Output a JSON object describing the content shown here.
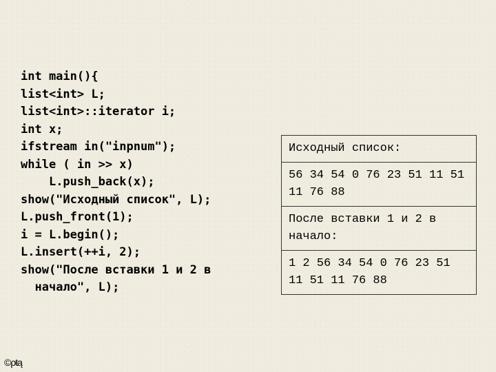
{
  "code": {
    "lines": [
      "int main(){",
      "list<int> L;",
      "list<int>::iterator i;",
      "int x;",
      "ifstream in(\"inpnum\");",
      "while ( in >> x)",
      "    L.push_back(x);",
      "show(\"Исходный список\", L);",
      "L.push_front(1);",
      "i = L.begin();",
      "L.insert(++i, 2);",
      "show(\"После вставки 1 и 2 в\n  начало\", L);"
    ]
  },
  "output": {
    "heading1": "Исходный список:",
    "values1": "56 34 54 0 76 23 51 11 51 11 76 88",
    "heading2": "После вставки 1 и 2 в начало:",
    "values2": "1 2 56 34 54 0 76 23 51 11 51 11 76 88"
  },
  "footer": "©ρŧą"
}
